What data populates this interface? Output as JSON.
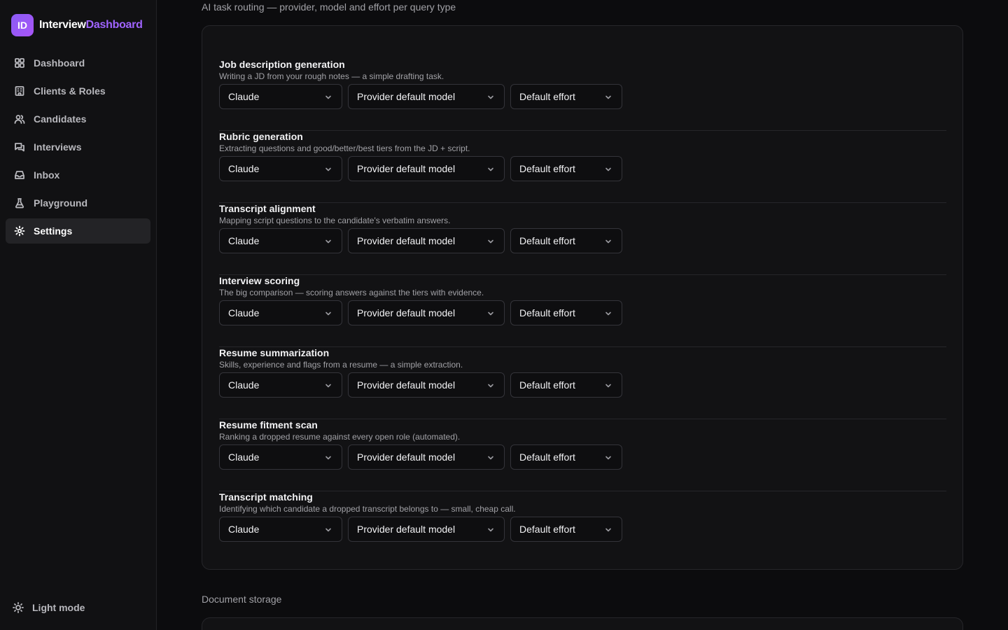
{
  "brand": {
    "logo": "ID",
    "name_a": "Interview",
    "name_b": "Dashboard"
  },
  "nav": [
    {
      "label": "Dashboard",
      "icon": "grid-icon",
      "active": false
    },
    {
      "label": "Clients & Roles",
      "icon": "building-icon",
      "active": false
    },
    {
      "label": "Candidates",
      "icon": "users-icon",
      "active": false
    },
    {
      "label": "Interviews",
      "icon": "chat-icon",
      "active": false
    },
    {
      "label": "Inbox",
      "icon": "inbox-icon",
      "active": false
    },
    {
      "label": "Playground",
      "icon": "flask-icon",
      "active": false
    },
    {
      "label": "Settings",
      "icon": "gear-icon",
      "active": true
    }
  ],
  "theme_toggle": {
    "label": "Light mode",
    "icon": "sun-icon"
  },
  "routing": {
    "title": "AI task routing — provider, model and effort per query type",
    "tasks": [
      {
        "name": "Job description generation",
        "desc": "Writing a JD from your rough notes — a simple drafting task.",
        "provider": "Claude",
        "model": "Provider default model",
        "effort": "Default effort"
      },
      {
        "name": "Rubric generation",
        "desc": "Extracting questions and good/better/best tiers from the JD + script.",
        "provider": "Claude",
        "model": "Provider default model",
        "effort": "Default effort"
      },
      {
        "name": "Transcript alignment",
        "desc": "Mapping script questions to the candidate's verbatim answers.",
        "provider": "Claude",
        "model": "Provider default model",
        "effort": "Default effort"
      },
      {
        "name": "Interview scoring",
        "desc": "The big comparison — scoring answers against the tiers with evidence.",
        "provider": "Claude",
        "model": "Provider default model",
        "effort": "Default effort"
      },
      {
        "name": "Resume summarization",
        "desc": "Skills, experience and flags from a resume — a simple extraction.",
        "provider": "Claude",
        "model": "Provider default model",
        "effort": "Default effort"
      },
      {
        "name": "Resume fitment scan",
        "desc": "Ranking a dropped resume against every open role (automated).",
        "provider": "Claude",
        "model": "Provider default model",
        "effort": "Default effort"
      },
      {
        "name": "Transcript matching",
        "desc": "Identifying which candidate a dropped transcript belongs to — small, cheap call.",
        "provider": "Claude",
        "model": "Provider default model",
        "effort": "Default effort"
      }
    ]
  },
  "storage": {
    "title": "Document storage"
  }
}
